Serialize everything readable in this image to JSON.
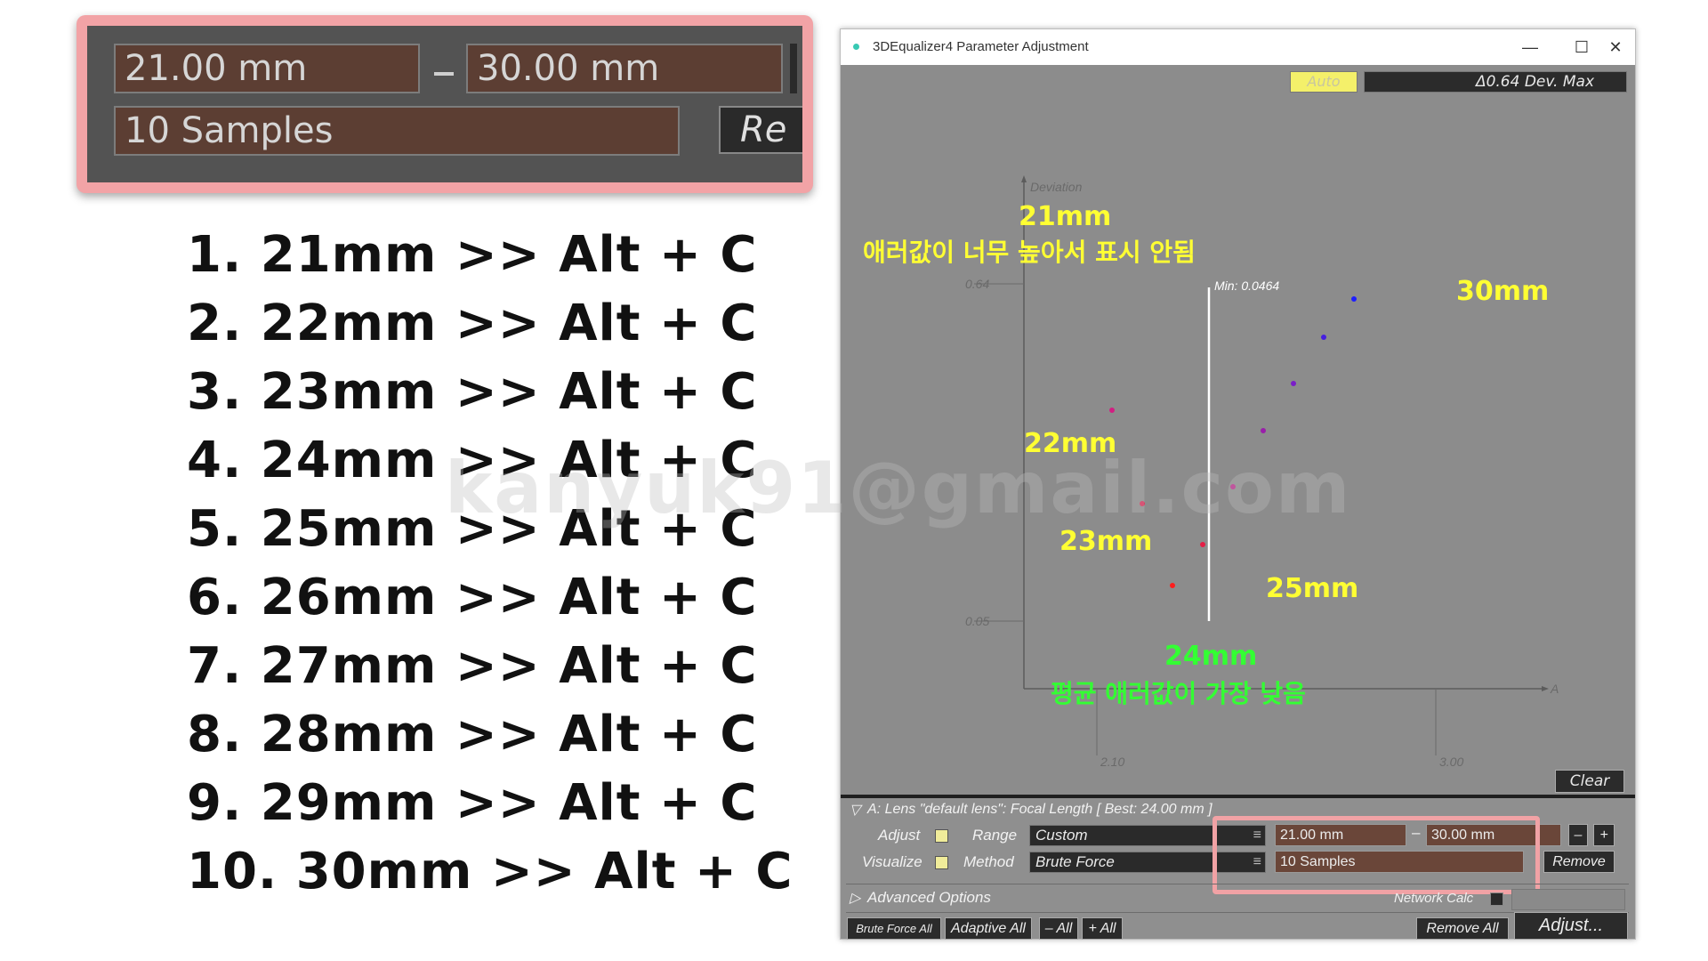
{
  "zoom": {
    "range_from": "21.00 mm",
    "range_to": "30.00 mm",
    "samples": "10 Samples",
    "remove_partial": "Re"
  },
  "steps": [
    "1. 21mm >> Alt + C",
    "2. 22mm >> Alt + C",
    "3. 23mm >> Alt + C",
    "4. 24mm >> Alt + C",
    "5. 25mm >> Alt + C",
    "6. 26mm >> Alt + C",
    "7. 27mm >> Alt + C",
    "8. 28mm >> Alt + C",
    "9. 29mm >> Alt + C",
    "10. 30mm >> Alt + C"
  ],
  "window": {
    "title": "3DEqualizer4 Parameter Adjustment",
    "minimize": "—",
    "maximize": "☐",
    "close": "✕"
  },
  "graph": {
    "auto_label": "Auto",
    "dev_max": "Δ0.64 Dev. Max",
    "clear_label": "Clear",
    "y_axis_label": "Deviation",
    "x_axis_label": "A",
    "y_ticks": [
      "0.64",
      "0.05"
    ],
    "x_ticks": [
      "2.10",
      "3.00"
    ],
    "min_label": "Min: 0.0464",
    "colors": {
      "axis": "#5c5c5c",
      "min_line": "#ffffff",
      "yellow_note": "#ffff33",
      "green_note": "#33ff33"
    },
    "points": [
      {
        "mm": 22,
        "color": "#d21e82"
      },
      {
        "mm": 23,
        "color": "#e41e50"
      },
      {
        "mm": 24,
        "color": "#ff1e1e"
      },
      {
        "mm": 25,
        "color": "#e41e46"
      },
      {
        "mm": 26,
        "color": "#c21e8c"
      },
      {
        "mm": 27,
        "color": "#9a1eaa"
      },
      {
        "mm": 28,
        "color": "#7a1ec8"
      },
      {
        "mm": 29,
        "color": "#461ee0"
      },
      {
        "mm": 30,
        "color": "#1e1eff"
      }
    ],
    "annotations": {
      "a21": "21mm",
      "a21_note": "애러값이 너무 높아서 표시 안됨",
      "a22": "22mm",
      "a23": "23mm",
      "a24": "24mm",
      "a24_note": "평균 애러값이 가장 낮음",
      "a25": "25mm",
      "a30": "30mm"
    }
  },
  "panel": {
    "header": "A: Lens \"default lens\": Focal Length   [ Best: 24.00 mm ]",
    "adjust_label": "Adjust",
    "visualize_label": "Visualize",
    "range_label": "Range",
    "method_label": "Method",
    "range_value": "Custom",
    "method_value": "Brute Force",
    "range_from": "21.00 mm",
    "range_to": "30.00 mm",
    "samples": "10 Samples",
    "remove_label": "Remove",
    "minus_label": "–",
    "plus_label": "+",
    "advanced_options": "Advanced Options",
    "network_calc": "Network Calc",
    "brute_force_all": "Brute Force All",
    "adaptive_all": "Adaptive All",
    "minus_all": "– All",
    "plus_all": "+ All",
    "remove_all": "Remove All",
    "adjust_btn": "Adjust..."
  },
  "watermark": "kanyuk91@gmail.com"
}
